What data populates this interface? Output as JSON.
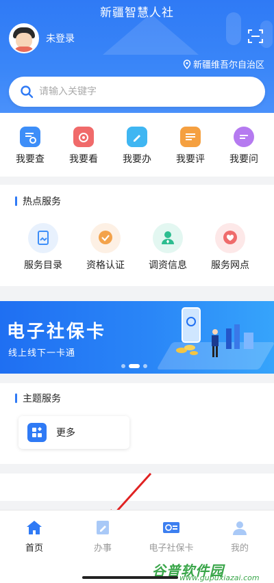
{
  "header": {
    "app_title": "新疆智慧人社",
    "login_text": "未登录",
    "region": "新疆维吾尔自治区",
    "icons": [
      "avatar",
      "scan-icon",
      "location-icon"
    ]
  },
  "search": {
    "placeholder": "请输入关键字",
    "icon": "search-icon"
  },
  "quick_actions": [
    {
      "label": "我要查",
      "icon": "query-icon",
      "color": "#3d8ef8"
    },
    {
      "label": "我要看",
      "icon": "view-icon",
      "color": "#f06a6a"
    },
    {
      "label": "我要办",
      "icon": "handle-icon",
      "color": "#3fb6f2"
    },
    {
      "label": "我要评",
      "icon": "review-icon",
      "color": "#f5a040"
    },
    {
      "label": "我要问",
      "icon": "ask-icon",
      "color": "#b57af0"
    }
  ],
  "hot_services": {
    "title": "热点服务",
    "items": [
      {
        "label": "服务目录",
        "icon": "catalog-icon",
        "bg": "#e8f1fd",
        "color": "#3d8ef8"
      },
      {
        "label": "资格认证",
        "icon": "certification-icon",
        "bg": "#fdf0e4",
        "color": "#f3a24a"
      },
      {
        "label": "调资信息",
        "icon": "salary-info-icon",
        "bg": "#e3f7f1",
        "color": "#2dbd90"
      },
      {
        "label": "服务网点",
        "icon": "service-location-icon",
        "bg": "#fde8e8",
        "color": "#ef6b6b"
      }
    ]
  },
  "banner": {
    "title": "电子社保卡",
    "subtitle": "线上线下一卡通",
    "page_count": 3,
    "active_page": 2
  },
  "theme_services": {
    "title": "主题服务",
    "more_label": "更多"
  },
  "tabbar": {
    "tabs": [
      {
        "label": "首页",
        "icon": "home-icon",
        "active": true
      },
      {
        "label": "办事",
        "icon": "edit-icon",
        "active": false
      },
      {
        "label": "电子社保卡",
        "icon": "card-icon",
        "active": false
      },
      {
        "label": "我的",
        "icon": "profile-icon",
        "active": false
      }
    ]
  },
  "watermark": {
    "text": "谷普软件园",
    "url": "www.gupuxiazai.com"
  },
  "colors": {
    "primary": "#2f7af5",
    "text": "#222222",
    "muted": "#999999"
  }
}
